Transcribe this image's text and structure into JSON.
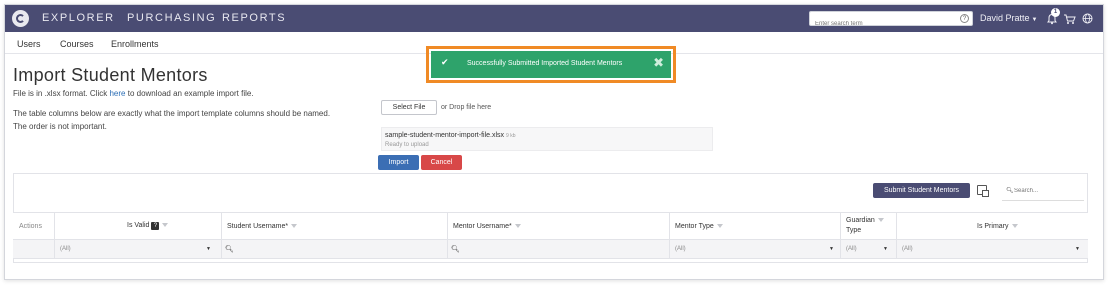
{
  "nav": {
    "links": [
      "EXPLORER",
      "PURCHASING",
      "REPORTS"
    ],
    "search_placeholder": "Enter search term",
    "help_icon": "?",
    "user_name": "David Pratte",
    "notification_count": "1"
  },
  "subnav": {
    "items": [
      "Users",
      "Courses",
      "Enrollments"
    ]
  },
  "page": {
    "title": "Import Student Mentors",
    "desc_prefix": "File is in .xlsx format. Click",
    "desc_link": "here",
    "desc_suffix": "to download an example import file.",
    "desc_line2": "The table columns below are exactly what the import template columns should be named.",
    "desc_line3": "The order is not important."
  },
  "upload": {
    "select_file_label": "Select File",
    "drop_text": "or Drop file here",
    "file_name": "sample-student-mentor-import-file.xlsx",
    "file_size": "9 kb",
    "file_status": "Ready to upload",
    "import_label": "Import",
    "cancel_label": "Cancel"
  },
  "toast": {
    "message": "Successfully Submitted Imported Student Mentors",
    "check_icon": "✔",
    "close_icon": "✖"
  },
  "grid": {
    "submit_label": "Submit Student Mentors",
    "search_placeholder": "Search...",
    "headers": {
      "actions": "Actions",
      "is_valid": "Is Valid",
      "is_valid_badge": "?",
      "student_username": "Student Username*",
      "mentor_username": "Mentor Username*",
      "mentor_type": "Mentor Type",
      "guardian_type_1": "Guardian",
      "guardian_type_2": "Type",
      "is_primary": "Is Primary"
    },
    "filters": {
      "is_valid": "(All)",
      "mentor_type": "(All)",
      "guardian_type": "(All)",
      "is_primary": "(All)"
    }
  },
  "colors": {
    "nav_bg": "#4a4c73",
    "toast_bg": "#2ea36b",
    "highlight_outline": "#f08a25",
    "import_btn": "#3b6eb4",
    "cancel_btn": "#d84848",
    "link": "#2a6db5"
  }
}
